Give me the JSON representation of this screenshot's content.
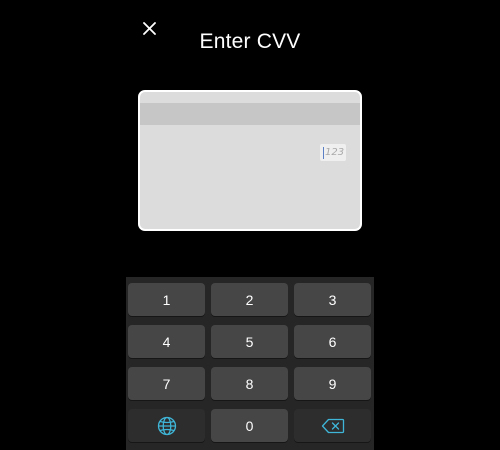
{
  "header": {
    "title": "Enter CVV",
    "close_icon": "close-icon"
  },
  "card": {
    "cvv_placeholder": "123"
  },
  "keypad": {
    "keys": [
      "1",
      "2",
      "3",
      "4",
      "5",
      "6",
      "7",
      "8",
      "9",
      "0"
    ],
    "globe_icon": "globe-icon",
    "backspace_icon": "backspace-icon",
    "accent_color": "#3fb6d8"
  },
  "colors": {
    "background": "#000000",
    "card": "#dcdcdc",
    "card_stripe": "#c6c6c6",
    "key": "#464646",
    "key_dark": "#2d2d2d",
    "keypad_bg": "#262626"
  }
}
